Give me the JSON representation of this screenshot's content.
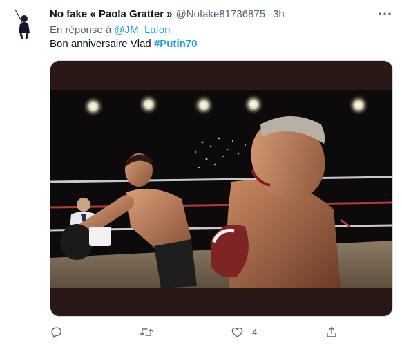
{
  "tweet": {
    "display_name": "No fake « Paola Gratter »",
    "handle": "@Nofake81736875",
    "separator": "·",
    "time": "3h",
    "reply_prefix": "En réponse à",
    "reply_mention": "@JM_Lafon",
    "text_plain": "Bon anniversaire Vlad",
    "hashtag": "#Putin70",
    "media_description": "Boxing ring photomontage: a boxer punching a bleeding, tilted head of an older man; referee on the left, spotlights above"
  },
  "actions": {
    "reply_count": "",
    "retweet_count": "",
    "like_count": "4",
    "share_count": ""
  },
  "icons": {
    "more": "more-horizontal-icon",
    "reply": "comment-bubble-icon",
    "retweet": "retweet-arrows-icon",
    "like": "heart-icon",
    "share": "share-upload-icon"
  },
  "colors": {
    "link": "#1d9bf0",
    "secondary_text": "#536471",
    "primary_text": "#0f1419"
  }
}
